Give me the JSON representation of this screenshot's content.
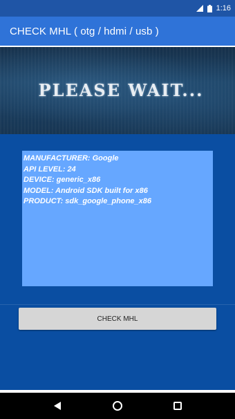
{
  "status_bar": {
    "time": "1:16",
    "icons": [
      "signal-icon",
      "battery-icon"
    ]
  },
  "app_bar": {
    "title": "CHECK MHL ( otg / hdmi / usb )"
  },
  "banner": {
    "text": "PLEASE WAIT..."
  },
  "device_info": {
    "lines": [
      "MANUFACTURER: Google",
      "API LEVEL: 24",
      "DEVICE: generic_x86",
      "MODEL: Android SDK built for x86",
      "PRODUCT: sdk_google_phone_x86"
    ]
  },
  "check_button": {
    "label": "CHECK MHL"
  },
  "nav_bar": {
    "buttons": [
      "back-icon",
      "home-icon",
      "recents-icon"
    ]
  },
  "colors": {
    "status_bar": "#1f55a6",
    "app_bar": "#2f73d8",
    "background": "#0a4ea2",
    "info_box": "#66a7ff",
    "button": "#d6d6d6"
  }
}
